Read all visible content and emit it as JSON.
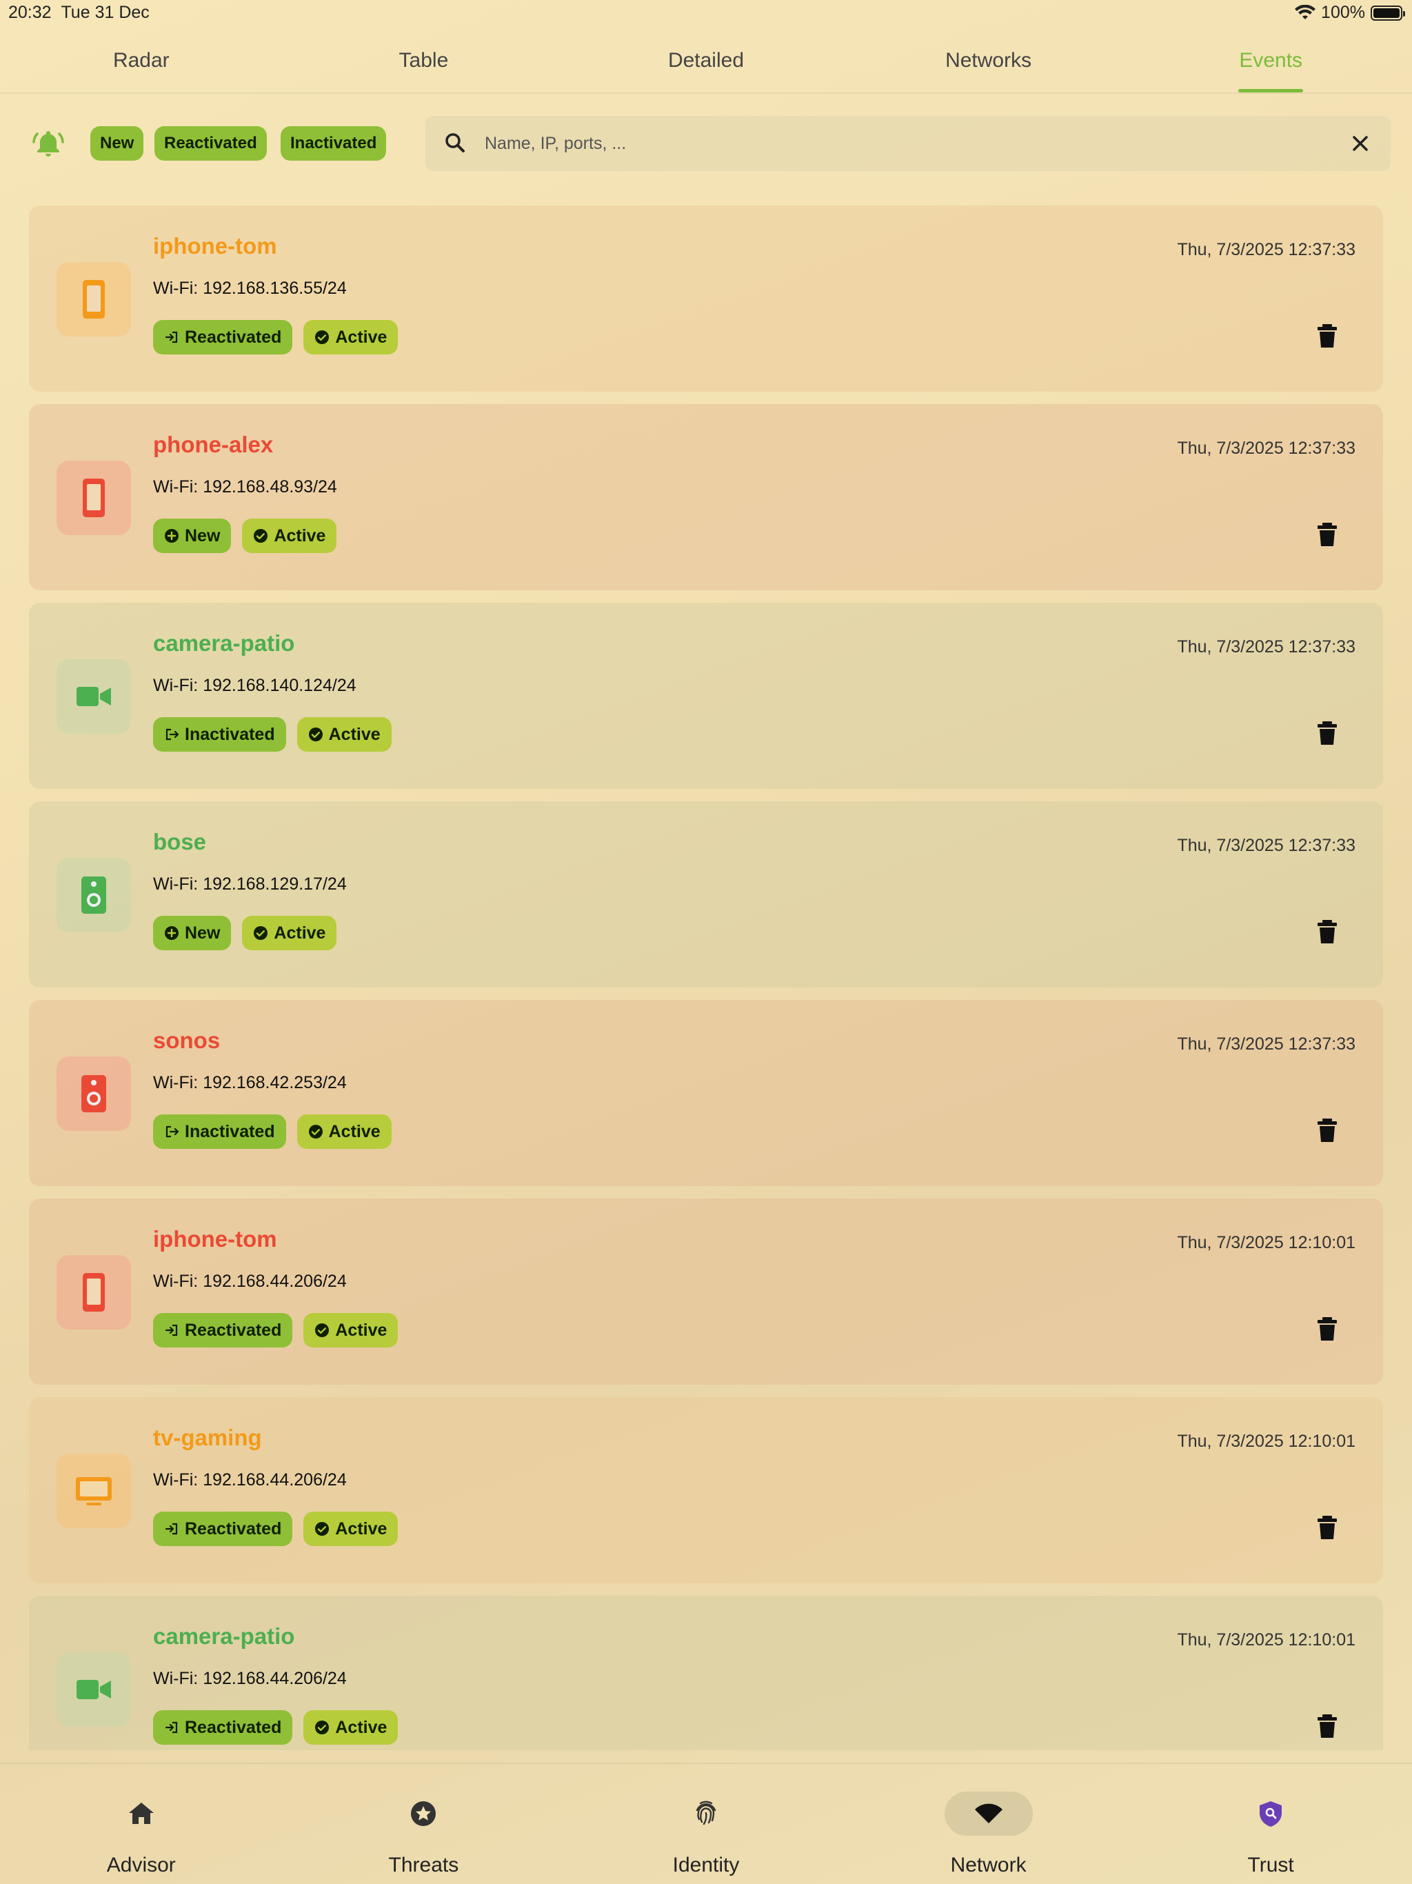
{
  "status_bar": {
    "time": "20:32",
    "date": "Tue 31 Dec",
    "battery": "100%"
  },
  "top_tabs": [
    {
      "label": "Radar",
      "active": false
    },
    {
      "label": "Table",
      "active": false
    },
    {
      "label": "Detailed",
      "active": false
    },
    {
      "label": "Networks",
      "active": false
    },
    {
      "label": "Events",
      "active": true
    }
  ],
  "filters": {
    "icon": "bell-ring-icon",
    "chips": [
      "New",
      "Reactivated",
      "Inactivated"
    ]
  },
  "search": {
    "placeholder": "Name, IP, ports, ...",
    "value": ""
  },
  "colors": {
    "accent": "#7cbc3c",
    "orange": "#f39a1a",
    "red": "#ea4a35",
    "green": "#4caf50",
    "chip": "#8fbf36",
    "status_chip": "#b6cc3a"
  },
  "events": [
    {
      "name": "iphone-tom",
      "color": "orange",
      "device_icon": "phone-icon",
      "time": "Thu, 7/3/2025 12:37:33",
      "ip": "Wi-Fi: 192.168.136.55/24",
      "event": "Reactivated",
      "event_icon": "login-icon",
      "status": "Active"
    },
    {
      "name": "phone-alex",
      "color": "red",
      "device_icon": "phone-icon",
      "time": "Thu, 7/3/2025 12:37:33",
      "ip": "Wi-Fi: 192.168.48.93/24",
      "event": "New",
      "event_icon": "plus-circle-icon",
      "status": "Active"
    },
    {
      "name": "camera-patio",
      "color": "green",
      "device_icon": "video-camera-icon",
      "time": "Thu, 7/3/2025 12:37:33",
      "ip": "Wi-Fi: 192.168.140.124/24",
      "event": "Inactivated",
      "event_icon": "logout-icon",
      "status": "Active"
    },
    {
      "name": "bose",
      "color": "green",
      "device_icon": "speaker-icon",
      "time": "Thu, 7/3/2025 12:37:33",
      "ip": "Wi-Fi: 192.168.129.17/24",
      "event": "New",
      "event_icon": "plus-circle-icon",
      "status": "Active"
    },
    {
      "name": "sonos",
      "color": "red",
      "device_icon": "speaker-icon",
      "time": "Thu, 7/3/2025 12:37:33",
      "ip": "Wi-Fi: 192.168.42.253/24",
      "event": "Inactivated",
      "event_icon": "logout-icon",
      "status": "Active"
    },
    {
      "name": "iphone-tom",
      "color": "red",
      "device_icon": "phone-icon",
      "time": "Thu, 7/3/2025 12:10:01",
      "ip": "Wi-Fi: 192.168.44.206/24",
      "event": "Reactivated",
      "event_icon": "login-icon",
      "status": "Active"
    },
    {
      "name": "tv-gaming",
      "color": "orange",
      "device_icon": "tv-icon",
      "time": "Thu, 7/3/2025 12:10:01",
      "ip": "Wi-Fi: 192.168.44.206/24",
      "event": "Reactivated",
      "event_icon": "login-icon",
      "status": "Active"
    },
    {
      "name": "camera-patio",
      "color": "green",
      "device_icon": "video-camera-icon",
      "time": "Thu, 7/3/2025 12:10:01",
      "ip": "Wi-Fi: 192.168.44.206/24",
      "event": "Reactivated",
      "event_icon": "login-icon",
      "status": "Active"
    }
  ],
  "bottom_nav": [
    {
      "label": "Advisor",
      "icon": "home-icon",
      "active": false
    },
    {
      "label": "Threats",
      "icon": "star-badge-icon",
      "active": false
    },
    {
      "label": "Identity",
      "icon": "fingerprint-icon",
      "active": false
    },
    {
      "label": "Network",
      "icon": "wifi-icon",
      "active": true
    },
    {
      "label": "Trust",
      "icon": "shield-search-icon",
      "active": false
    }
  ]
}
